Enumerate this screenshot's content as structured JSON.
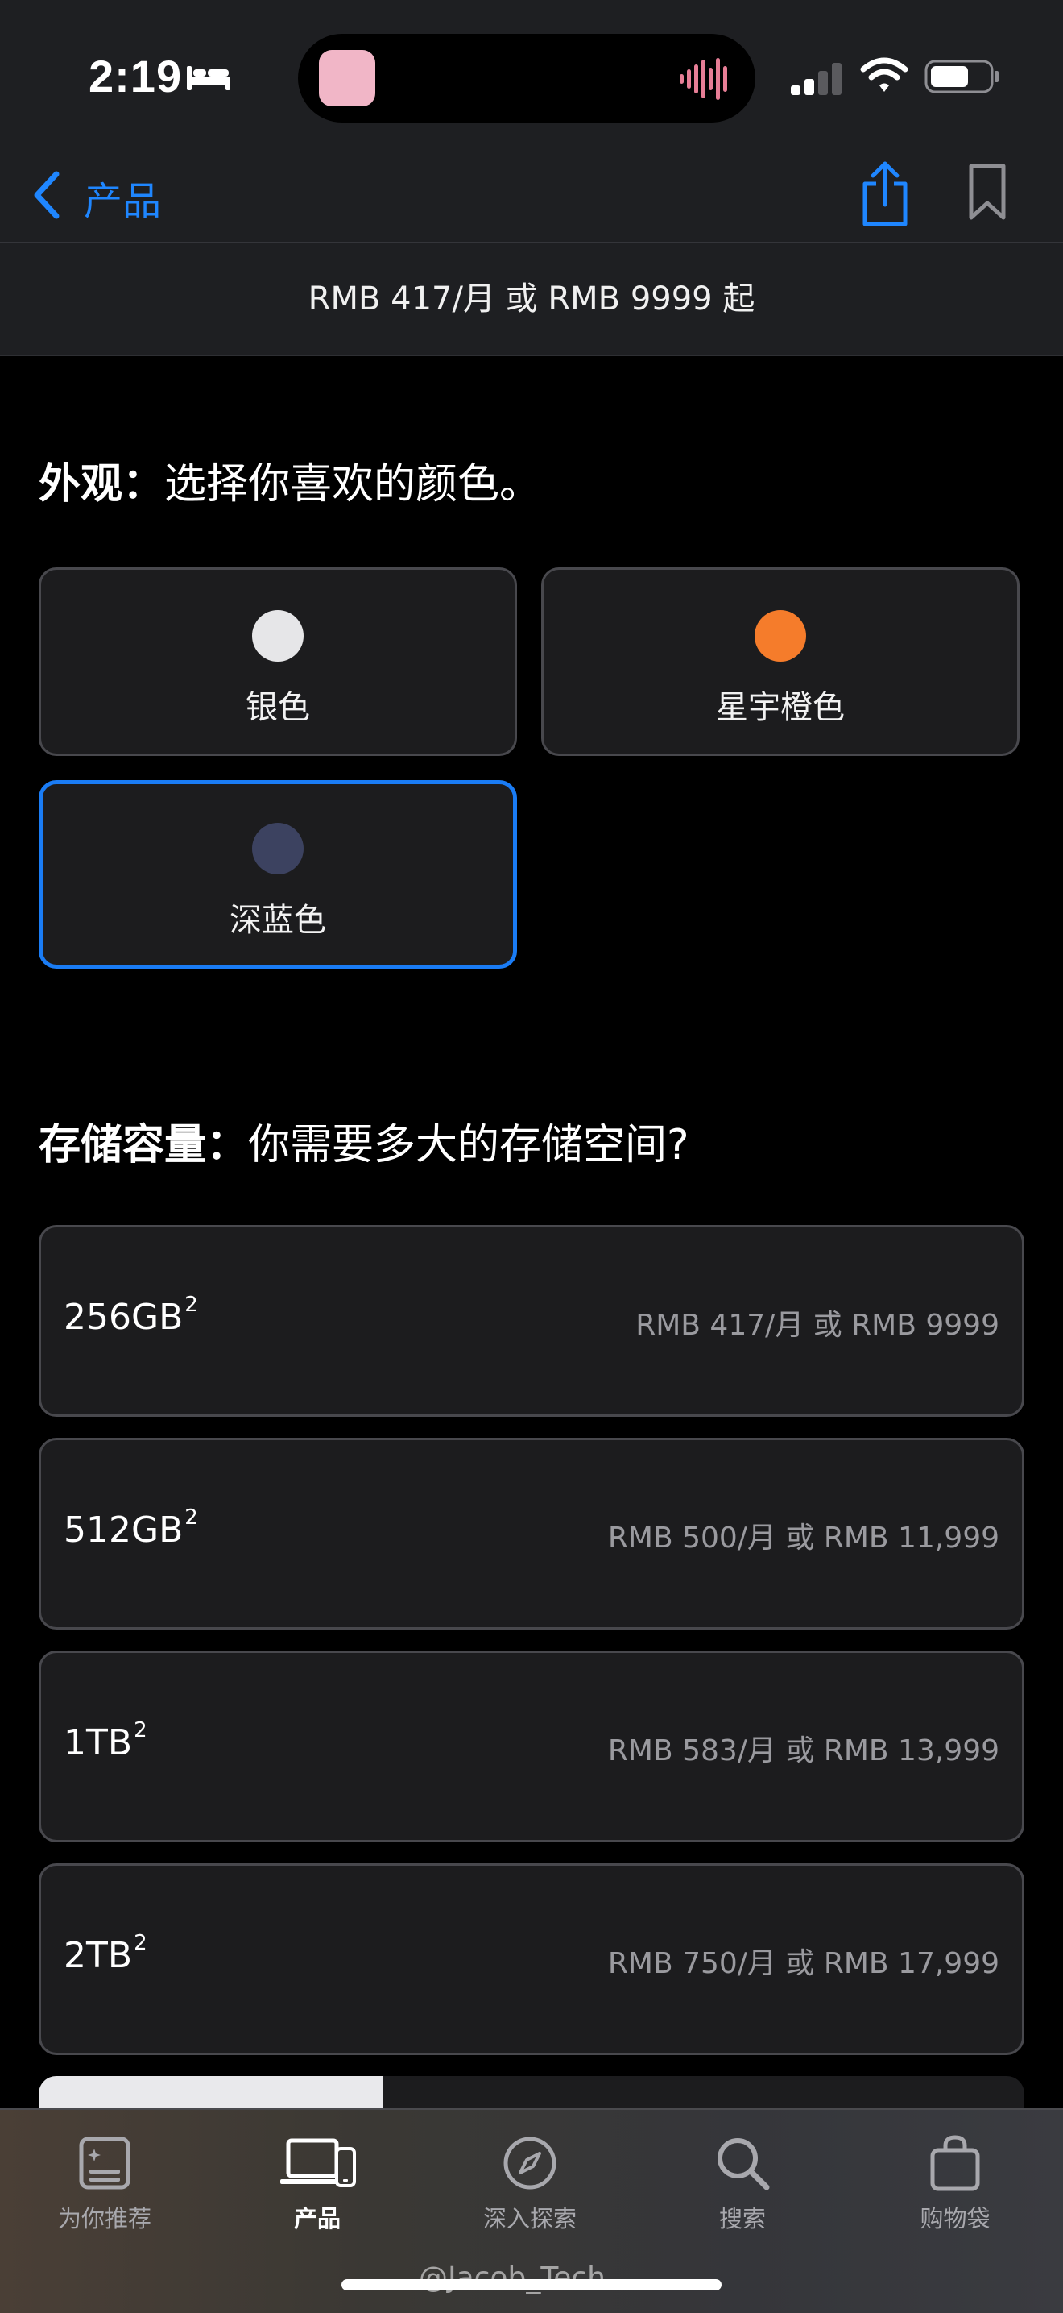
{
  "status_bar": {
    "time": "2:19",
    "icons": [
      "bed-icon",
      "sound-wave-icon",
      "cellular-signal-icon",
      "wifi-icon",
      "battery-icon"
    ]
  },
  "nav": {
    "back_label": "产品",
    "icons": [
      "chevron-left-icon",
      "share-icon",
      "bookmark-icon"
    ],
    "accent_color": "#1f86ff"
  },
  "price_banner": "RMB 417/月 或 RMB 9999 起",
  "appearance": {
    "heading_bold": "外观：",
    "heading_rest": "选择你喜欢的颜色。",
    "options": [
      {
        "label": "银色",
        "swatch": "#e6e6e8",
        "selected": false
      },
      {
        "label": "星宇橙色",
        "swatch": "#f57c2b",
        "selected": false
      },
      {
        "label": "深蓝色",
        "swatch": "#3c4260",
        "selected": true
      }
    ],
    "selected_border_color": "#1a7cf5"
  },
  "storage": {
    "heading_bold": "存储容量：",
    "heading_rest": "你需要多大的存储空间?",
    "options": [
      {
        "size": "256GB",
        "footnote": "2",
        "price": "RMB 417/月 或 RMB 9999"
      },
      {
        "size": "512GB",
        "footnote": "2",
        "price": "RMB 500/月 或 RMB 11,999"
      },
      {
        "size": "1TB",
        "footnote": "2",
        "price": "RMB 583/月 或 RMB 13,999"
      },
      {
        "size": "2TB",
        "footnote": "2",
        "price": "RMB 750/月 或 RMB 17,999"
      }
    ]
  },
  "tab_bar": {
    "tabs": [
      {
        "label": "为你推荐",
        "icon": "for-you-icon",
        "active": false
      },
      {
        "label": "产品",
        "icon": "products-icon",
        "active": true
      },
      {
        "label": "深入探索",
        "icon": "compass-icon",
        "active": false
      },
      {
        "label": "搜索",
        "icon": "search-icon",
        "active": false
      },
      {
        "label": "购物袋",
        "icon": "bag-icon",
        "active": false
      }
    ]
  },
  "watermark": "@Jacob_Tech"
}
